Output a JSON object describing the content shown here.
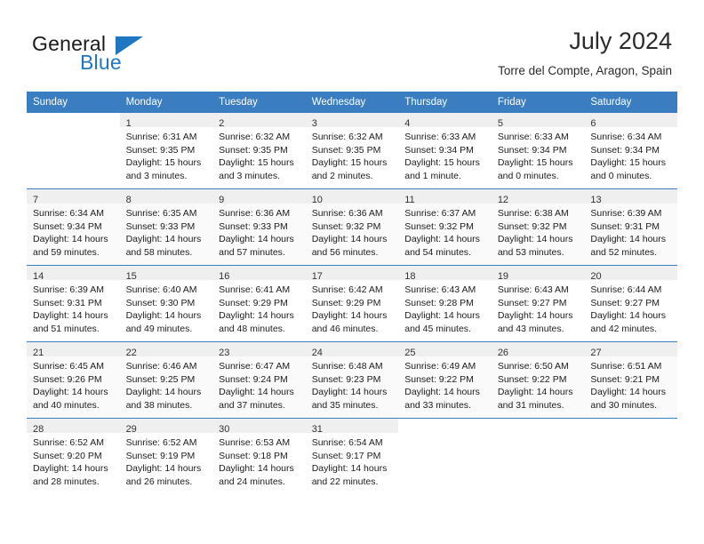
{
  "brand": {
    "word1": "General",
    "word2": "Blue",
    "accent_color": "#1f77c2"
  },
  "header": {
    "title": "July 2024",
    "location": "Torre del Compte, Aragon, Spain"
  },
  "calendar": {
    "header_bg": "#3a7dc0",
    "weekdays": [
      "Sunday",
      "Monday",
      "Tuesday",
      "Wednesday",
      "Thursday",
      "Friday",
      "Saturday"
    ],
    "weeks": [
      [
        {
          "day": "",
          "lines": []
        },
        {
          "day": "1",
          "lines": [
            "Sunrise: 6:31 AM",
            "Sunset: 9:35 PM",
            "Daylight: 15 hours",
            "and 3 minutes."
          ]
        },
        {
          "day": "2",
          "lines": [
            "Sunrise: 6:32 AM",
            "Sunset: 9:35 PM",
            "Daylight: 15 hours",
            "and 3 minutes."
          ]
        },
        {
          "day": "3",
          "lines": [
            "Sunrise: 6:32 AM",
            "Sunset: 9:35 PM",
            "Daylight: 15 hours",
            "and 2 minutes."
          ]
        },
        {
          "day": "4",
          "lines": [
            "Sunrise: 6:33 AM",
            "Sunset: 9:34 PM",
            "Daylight: 15 hours",
            "and 1 minute."
          ]
        },
        {
          "day": "5",
          "lines": [
            "Sunrise: 6:33 AM",
            "Sunset: 9:34 PM",
            "Daylight: 15 hours",
            "and 0 minutes."
          ]
        },
        {
          "day": "6",
          "lines": [
            "Sunrise: 6:34 AM",
            "Sunset: 9:34 PM",
            "Daylight: 15 hours",
            "and 0 minutes."
          ]
        }
      ],
      [
        {
          "day": "7",
          "lines": [
            "Sunrise: 6:34 AM",
            "Sunset: 9:34 PM",
            "Daylight: 14 hours",
            "and 59 minutes."
          ]
        },
        {
          "day": "8",
          "lines": [
            "Sunrise: 6:35 AM",
            "Sunset: 9:33 PM",
            "Daylight: 14 hours",
            "and 58 minutes."
          ]
        },
        {
          "day": "9",
          "lines": [
            "Sunrise: 6:36 AM",
            "Sunset: 9:33 PM",
            "Daylight: 14 hours",
            "and 57 minutes."
          ]
        },
        {
          "day": "10",
          "lines": [
            "Sunrise: 6:36 AM",
            "Sunset: 9:32 PM",
            "Daylight: 14 hours",
            "and 56 minutes."
          ]
        },
        {
          "day": "11",
          "lines": [
            "Sunrise: 6:37 AM",
            "Sunset: 9:32 PM",
            "Daylight: 14 hours",
            "and 54 minutes."
          ]
        },
        {
          "day": "12",
          "lines": [
            "Sunrise: 6:38 AM",
            "Sunset: 9:32 PM",
            "Daylight: 14 hours",
            "and 53 minutes."
          ]
        },
        {
          "day": "13",
          "lines": [
            "Sunrise: 6:39 AM",
            "Sunset: 9:31 PM",
            "Daylight: 14 hours",
            "and 52 minutes."
          ]
        }
      ],
      [
        {
          "day": "14",
          "lines": [
            "Sunrise: 6:39 AM",
            "Sunset: 9:31 PM",
            "Daylight: 14 hours",
            "and 51 minutes."
          ]
        },
        {
          "day": "15",
          "lines": [
            "Sunrise: 6:40 AM",
            "Sunset: 9:30 PM",
            "Daylight: 14 hours",
            "and 49 minutes."
          ]
        },
        {
          "day": "16",
          "lines": [
            "Sunrise: 6:41 AM",
            "Sunset: 9:29 PM",
            "Daylight: 14 hours",
            "and 48 minutes."
          ]
        },
        {
          "day": "17",
          "lines": [
            "Sunrise: 6:42 AM",
            "Sunset: 9:29 PM",
            "Daylight: 14 hours",
            "and 46 minutes."
          ]
        },
        {
          "day": "18",
          "lines": [
            "Sunrise: 6:43 AM",
            "Sunset: 9:28 PM",
            "Daylight: 14 hours",
            "and 45 minutes."
          ]
        },
        {
          "day": "19",
          "lines": [
            "Sunrise: 6:43 AM",
            "Sunset: 9:27 PM",
            "Daylight: 14 hours",
            "and 43 minutes."
          ]
        },
        {
          "day": "20",
          "lines": [
            "Sunrise: 6:44 AM",
            "Sunset: 9:27 PM",
            "Daylight: 14 hours",
            "and 42 minutes."
          ]
        }
      ],
      [
        {
          "day": "21",
          "lines": [
            "Sunrise: 6:45 AM",
            "Sunset: 9:26 PM",
            "Daylight: 14 hours",
            "and 40 minutes."
          ]
        },
        {
          "day": "22",
          "lines": [
            "Sunrise: 6:46 AM",
            "Sunset: 9:25 PM",
            "Daylight: 14 hours",
            "and 38 minutes."
          ]
        },
        {
          "day": "23",
          "lines": [
            "Sunrise: 6:47 AM",
            "Sunset: 9:24 PM",
            "Daylight: 14 hours",
            "and 37 minutes."
          ]
        },
        {
          "day": "24",
          "lines": [
            "Sunrise: 6:48 AM",
            "Sunset: 9:23 PM",
            "Daylight: 14 hours",
            "and 35 minutes."
          ]
        },
        {
          "day": "25",
          "lines": [
            "Sunrise: 6:49 AM",
            "Sunset: 9:22 PM",
            "Daylight: 14 hours",
            "and 33 minutes."
          ]
        },
        {
          "day": "26",
          "lines": [
            "Sunrise: 6:50 AM",
            "Sunset: 9:22 PM",
            "Daylight: 14 hours",
            "and 31 minutes."
          ]
        },
        {
          "day": "27",
          "lines": [
            "Sunrise: 6:51 AM",
            "Sunset: 9:21 PM",
            "Daylight: 14 hours",
            "and 30 minutes."
          ]
        }
      ],
      [
        {
          "day": "28",
          "lines": [
            "Sunrise: 6:52 AM",
            "Sunset: 9:20 PM",
            "Daylight: 14 hours",
            "and 28 minutes."
          ]
        },
        {
          "day": "29",
          "lines": [
            "Sunrise: 6:52 AM",
            "Sunset: 9:19 PM",
            "Daylight: 14 hours",
            "and 26 minutes."
          ]
        },
        {
          "day": "30",
          "lines": [
            "Sunrise: 6:53 AM",
            "Sunset: 9:18 PM",
            "Daylight: 14 hours",
            "and 24 minutes."
          ]
        },
        {
          "day": "31",
          "lines": [
            "Sunrise: 6:54 AM",
            "Sunset: 9:17 PM",
            "Daylight: 14 hours",
            "and 22 minutes."
          ]
        },
        {
          "day": "",
          "lines": []
        },
        {
          "day": "",
          "lines": []
        },
        {
          "day": "",
          "lines": []
        }
      ]
    ]
  }
}
